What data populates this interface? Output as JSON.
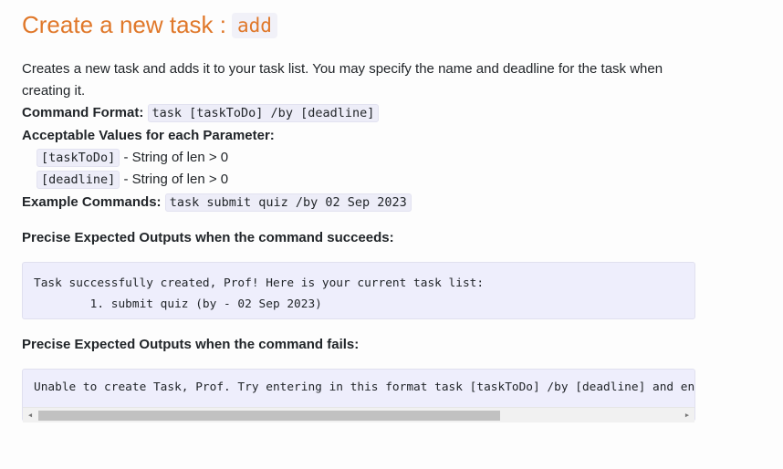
{
  "heading": {
    "text": "Create a new task : ",
    "command": "add"
  },
  "description": "Creates a new task and adds it to your task list. You may specify the name and deadline for the task when creating it.",
  "command_format": {
    "label": "Command Format:",
    "value": "task [taskToDo] /by [deadline]"
  },
  "params": {
    "label": "Acceptable Values for each Parameter:",
    "items": [
      {
        "name": "[taskToDo]",
        "desc": " - String of len > 0"
      },
      {
        "name": "[deadline]",
        "desc": " - String of len > 0"
      }
    ]
  },
  "example": {
    "label": "Example Commands:",
    "value": "task submit quiz /by 02 Sep 2023"
  },
  "success": {
    "heading": "Precise Expected Outputs when the command succeeds:",
    "line1": "Task successfully created, Prof! Here is your current task list:",
    "line2": "        1. submit quiz (by - 02 Sep 2023)"
  },
  "failure": {
    "heading": "Precise Expected Outputs when the command fails:",
    "line1": "Unable to create Task, Prof. Try entering in this format task [taskToDo] /by [deadline] and en"
  },
  "icons": {
    "scroll_left": "triangle-left",
    "scroll_right": "triangle-right"
  }
}
